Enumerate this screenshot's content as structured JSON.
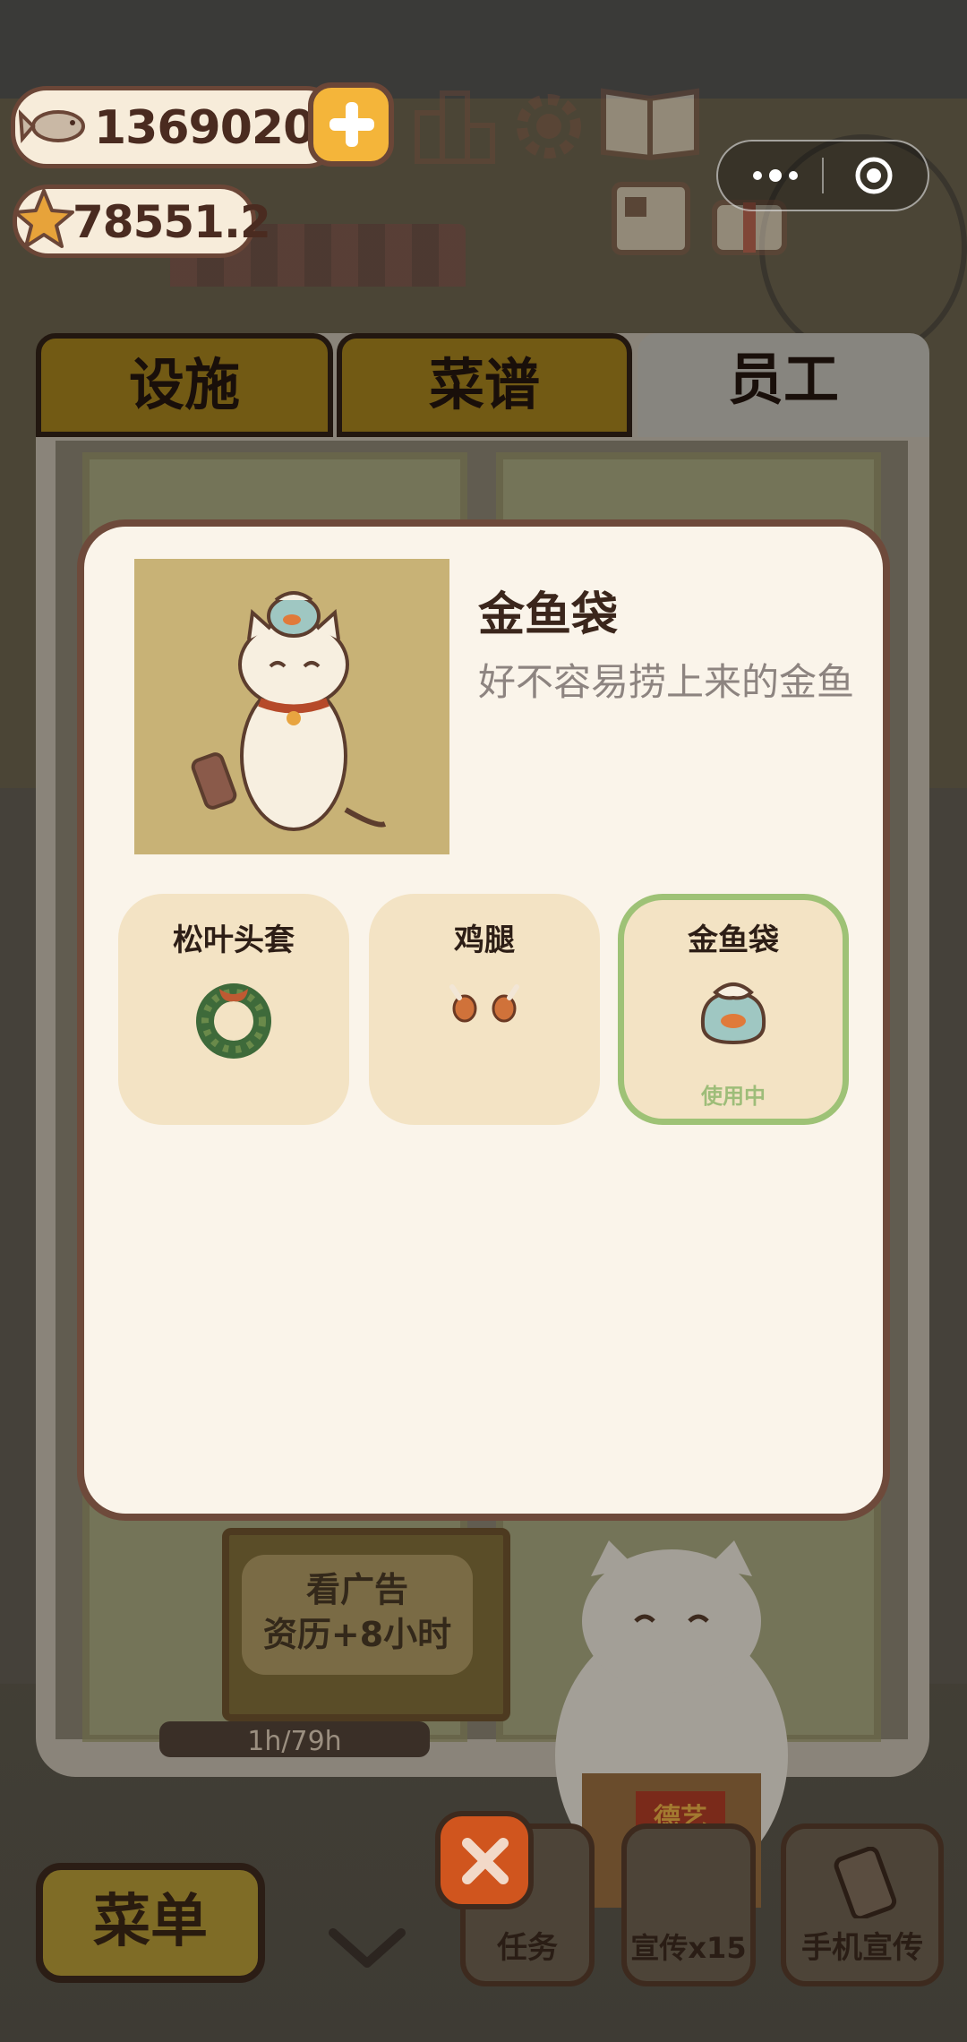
{
  "currency": {
    "fish": "1369020",
    "stars": "78551.2"
  },
  "tabs": [
    {
      "label": "设施"
    },
    {
      "label": "菜谱"
    },
    {
      "label": "员工"
    }
  ],
  "item": {
    "name": "金鱼袋",
    "desc": "好不容易捞上来的金鱼"
  },
  "accessories": [
    {
      "label": "松叶头套",
      "icon": "pine-wreath-icon"
    },
    {
      "label": "鸡腿",
      "icon": "drumstick-icon"
    },
    {
      "label": "金鱼袋",
      "icon": "goldfish-bag-icon",
      "status": "使用中"
    }
  ],
  "ad": {
    "line1": "看广告",
    "line2": "资历+8小时"
  },
  "progress": {
    "text": "1h/79h"
  },
  "bottom": {
    "menu": "菜单",
    "task": "任务",
    "promo": "宣传x15",
    "phone": "手机宣传",
    "banner": "德艺双馨"
  },
  "colors": {
    "selected_border": "#9ec276",
    "card_bg": "#f3e3c4",
    "modal_bg": "#faf4ea",
    "accent_orange": "#d0551e"
  }
}
